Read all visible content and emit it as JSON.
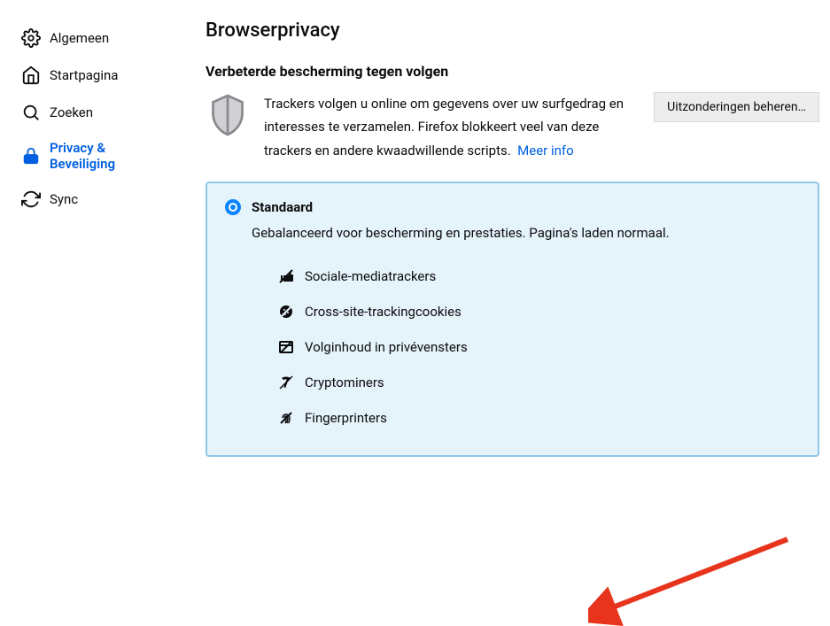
{
  "sidebar": {
    "items": [
      {
        "label": "Algemeen"
      },
      {
        "label": "Startpagina"
      },
      {
        "label": "Zoeken"
      },
      {
        "label": "Privacy & Beveiliging"
      },
      {
        "label": "Sync"
      }
    ]
  },
  "main": {
    "page_title": "Browserprivacy",
    "section_title": "Verbeterde bescherming tegen volgen",
    "intro_text": "Trackers volgen u online om gegevens over uw surfgedrag en interesses te verzamelen. Firefox blokkeert veel van deze trackers en andere kwaadwillende scripts.",
    "more_info": "Meer info",
    "exceptions_button": "Uitzonderingen beheren…",
    "card": {
      "title": "Standaard",
      "description": "Gebalanceerd voor bescherming en prestaties. Pagina's laden normaal.",
      "trackers": [
        {
          "label": "Sociale-mediatrackers"
        },
        {
          "label": "Cross-site-trackingcookies"
        },
        {
          "label": "Volginhoud in privévensters"
        },
        {
          "label": "Cryptominers"
        },
        {
          "label": "Fingerprinters"
        }
      ]
    }
  }
}
